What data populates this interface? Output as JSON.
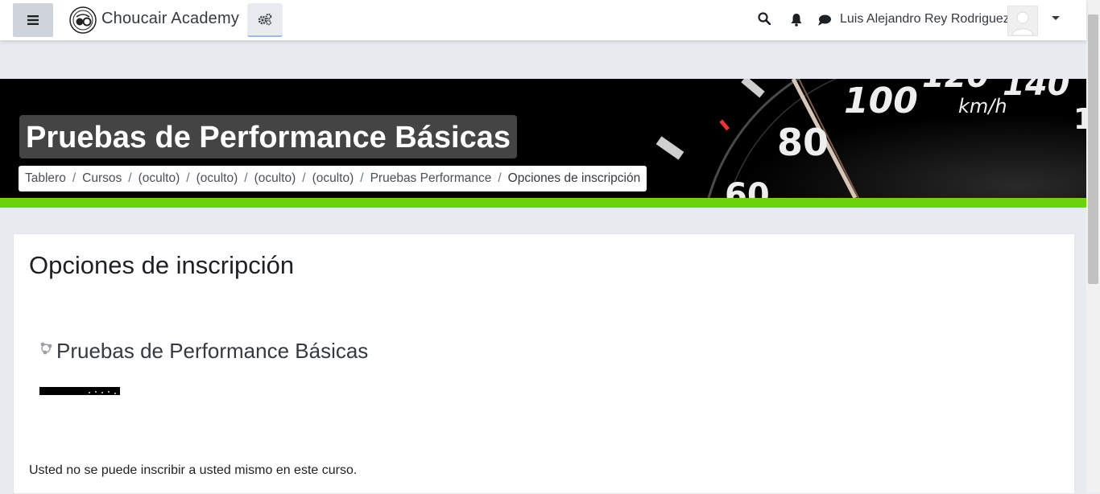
{
  "navbar": {
    "brand": "Choucair Academy",
    "user_name": "Luis Alejandro Rey Rodriguez",
    "icons": [
      "menu-icon",
      "logo-icon",
      "admin-gears-icon",
      "search-icon",
      "bell-icon",
      "chat-icon",
      "chevron-down-icon"
    ]
  },
  "header": {
    "course_title": "Pruebas de Performance Básicas",
    "breadcrumb": [
      "Tablero",
      "Cursos",
      "(oculto)",
      "(oculto)",
      "(oculto)",
      "(oculto)",
      "Pruebas Performance",
      "Opciones de inscripción"
    ],
    "accent_color": "#6bd30b"
  },
  "main": {
    "heading": "Opciones de inscripción",
    "course_name": "Pruebas de Performance Básicas",
    "notice": "Usted no se puede inscribir a usted mismo en este curso."
  }
}
